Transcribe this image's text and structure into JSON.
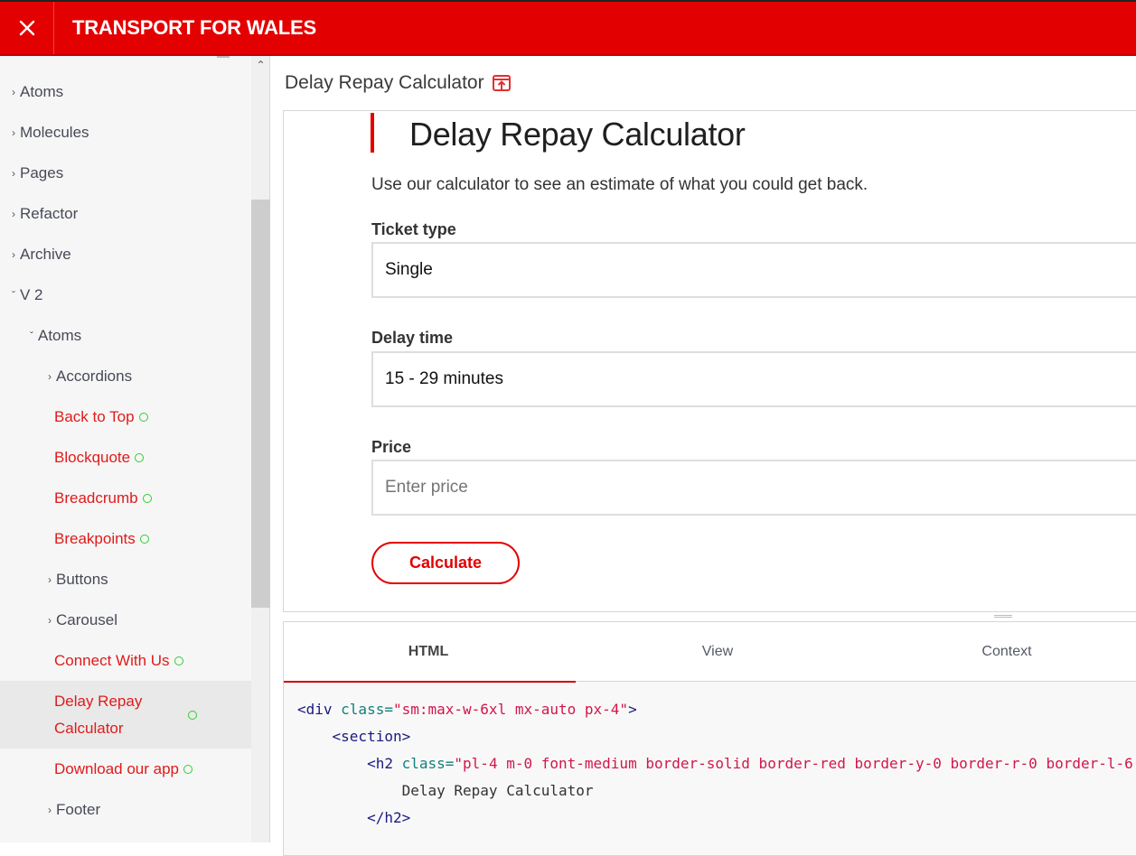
{
  "header": {
    "brand": "TRANSPORT FOR WALES",
    "close_icon": "close-icon",
    "colors": {
      "brand_red": "#e30000",
      "link_red": "#e01b1b",
      "status_green": "#33cc33"
    }
  },
  "sidebar": {
    "items": [
      {
        "label": "Atoms",
        "chevron": "›",
        "level": 0,
        "type": "group",
        "expanded": false
      },
      {
        "label": "Molecules",
        "chevron": "›",
        "level": 0,
        "type": "group",
        "expanded": false
      },
      {
        "label": "Pages",
        "chevron": "›",
        "level": 0,
        "type": "group",
        "expanded": false
      },
      {
        "label": "Refactor",
        "chevron": "›",
        "level": 0,
        "type": "group",
        "expanded": false
      },
      {
        "label": "Archive",
        "chevron": "›",
        "level": 0,
        "type": "group",
        "expanded": false
      },
      {
        "label": "V 2",
        "chevron": "ˇ",
        "level": 0,
        "type": "group",
        "expanded": true
      },
      {
        "label": "Atoms",
        "chevron": "ˇ",
        "level": 1,
        "type": "group",
        "expanded": true
      },
      {
        "label": "Accordions",
        "chevron": "›",
        "level": 2,
        "type": "group",
        "expanded": false
      },
      {
        "label": "Back to Top",
        "level": 2,
        "type": "leaf",
        "status": "ready"
      },
      {
        "label": "Blockquote",
        "level": 2,
        "type": "leaf",
        "status": "ready"
      },
      {
        "label": "Breadcrumb",
        "level": 2,
        "type": "leaf",
        "status": "ready"
      },
      {
        "label": "Breakpoints",
        "level": 2,
        "type": "leaf",
        "status": "ready"
      },
      {
        "label": "Buttons",
        "chevron": "›",
        "level": 2,
        "type": "group",
        "expanded": false
      },
      {
        "label": "Carousel",
        "chevron": "›",
        "level": 2,
        "type": "group",
        "expanded": false
      },
      {
        "label": "Connect With Us",
        "level": 2,
        "type": "leaf",
        "status": "ready"
      },
      {
        "label": "Delay Repay Calculator",
        "level": 2,
        "type": "leaf",
        "status": "ready",
        "active": true
      },
      {
        "label": "Download our app",
        "level": 2,
        "type": "leaf",
        "status": "ready"
      },
      {
        "label": "Footer",
        "chevron": "›",
        "level": 2,
        "type": "group",
        "expanded": false
      }
    ]
  },
  "main": {
    "breadcrumb_title": "Delay Repay Calculator",
    "open_icon": "open-in-new-icon",
    "preview": {
      "heading": "Delay Repay Calculator",
      "intro": "Use our calculator to see an estimate of what you could get back.",
      "fields": [
        {
          "label": "Ticket type",
          "value": "Single",
          "kind": "select"
        },
        {
          "label": "Delay time",
          "value": "15 - 29 minutes",
          "kind": "select"
        },
        {
          "label": "Price",
          "value": "",
          "placeholder": "Enter price",
          "kind": "input"
        }
      ],
      "button_label": "Calculate"
    },
    "tabs": [
      {
        "label": "HTML",
        "active": true
      },
      {
        "label": "View",
        "active": false
      },
      {
        "label": "Context",
        "active": false
      }
    ],
    "code": {
      "l1_open": "<div",
      "l1_attr": " class=",
      "l1_val": "\"sm:max-w-6xl mx-auto px-4\"",
      "l1_close": ">",
      "l2": "<section>",
      "l3_open": "<h2",
      "l3_attr": " class=",
      "l3_val": "\"pl-4 m-0 font-medium border-solid border-red border-y-0 border-r-0 border-l-6",
      "l4": "Delay Repay Calculator",
      "l5": "</h2>"
    }
  }
}
